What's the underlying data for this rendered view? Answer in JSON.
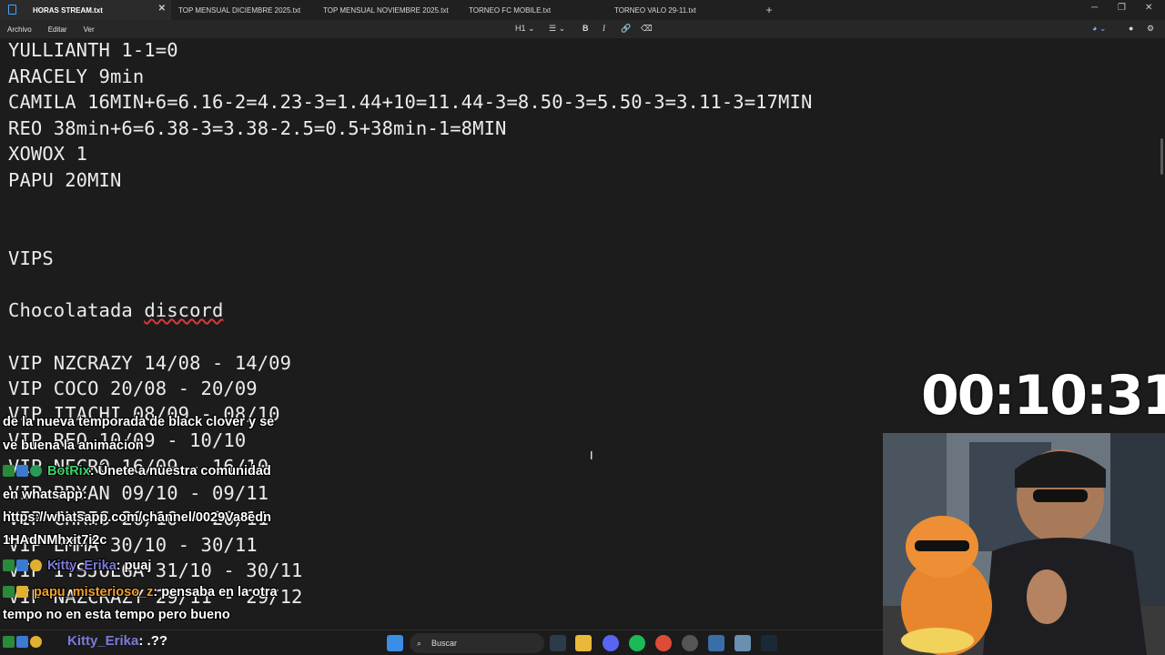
{
  "tabs": [
    {
      "label": "HORAS STREAM.txt",
      "active": true
    },
    {
      "label": "TOP MENSUAL DICIEMBRE 2025.txt",
      "active": false
    },
    {
      "label": "TOP MENSUAL NOVIEMBRE 2025.txt",
      "active": false
    },
    {
      "label": "TORNEO FC MOBILE.txt",
      "active": false
    },
    {
      "label": "TORNEO VALO 29-11.txt",
      "active": false
    }
  ],
  "new_tab_label": "+",
  "menu": {
    "archivo": "Archivo",
    "editar": "Editar",
    "ver": "Ver"
  },
  "format_toolbar": {
    "heading": "H1",
    "bold": "B",
    "italic": "I"
  },
  "editor_lines": [
    "YULLIANTH 1-1=0",
    "ARACELY 9min",
    "CAMILA 16MIN+6=6.16-2=4.23-3=1.44+10=11.44-3=8.50-3=5.50-3=3.11-3=17MIN",
    "REO 38min+6=6.38-3=3.38-2.5=0.5+38min-1=8MIN",
    "XOWOX 1",
    "PAPU 20MIN",
    "",
    "",
    "VIPS",
    "",
    "Chocolatada discord",
    "",
    "VIP NZCRAZY 14/08 - 14/09",
    "VIP COCO 20/08 - 20/09",
    "VIP ITACHI 08/09 - 08/10",
    "VIP REO 10/09 - 10/10",
    "VIP NECRO 16/09 - 16/10",
    "VIP BRYAN 09/10 - 09/11",
    "VIP CHRIS 20/10 - 20/11",
    "VIP EMMA 30/10 - 30/11",
    "VIP ITSJOEGA 31/10 - 30/11",
    "VIP NAZCRAZY 29/11 - 29/12"
  ],
  "timer": "00:10:31",
  "chat": [
    {
      "user": "",
      "message": "de la nueva temporada de black clover y se"
    },
    {
      "user": "",
      "message": "ve buena la animacion"
    },
    {
      "user": "BotRix",
      "message": ": Únete a nuestra comunidad"
    },
    {
      "user": "",
      "message": "en whatsapp:"
    },
    {
      "user": "",
      "message": "https://whatsapp.com/channel/0029Va8edn"
    },
    {
      "user": "",
      "message": "1HAdNMhxit7i2c"
    },
    {
      "user": "Kitty_Erika",
      "message": ": puaj"
    },
    {
      "user": "papu_misterioso_z",
      "message": ": pensaba en la otra"
    },
    {
      "user": "",
      "message": "tempo no en esta tempo pero bueno"
    }
  ],
  "bottom_chat": {
    "user": "Kitty_Erika",
    "message": ": .??"
  },
  "taskbar": {
    "search_placeholder": "Buscar"
  },
  "colors": {
    "bot_green": "#3fd36b",
    "kitty_purple": "#7a7ad9",
    "papu_orange": "#f0a030"
  }
}
